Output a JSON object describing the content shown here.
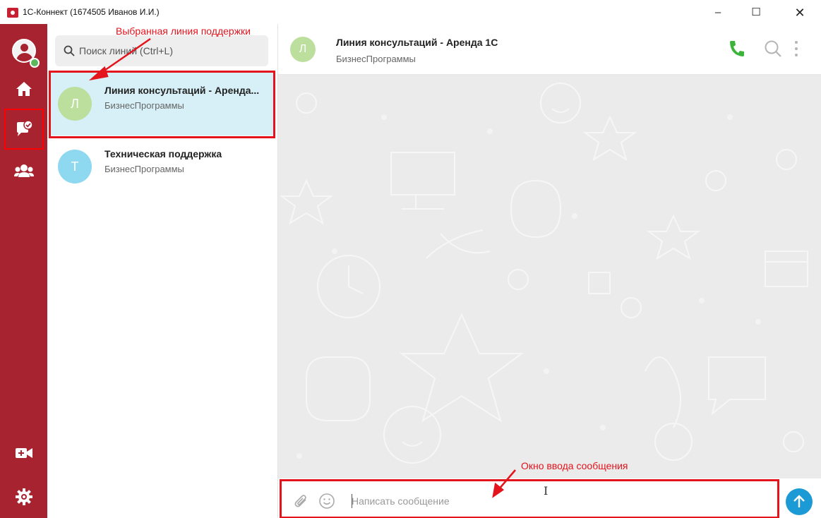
{
  "window": {
    "title": "1С-Коннект (1674505 Иванов И.И.)",
    "minimize_glyph": "–",
    "maximize_glyph": "☐",
    "close_glyph": "✕"
  },
  "rail": {
    "items": [
      {
        "name": "profile-avatar",
        "icon": "user-avatar-icon"
      },
      {
        "name": "home",
        "icon": "home-icon"
      },
      {
        "name": "support-lines",
        "icon": "chat-check-icon",
        "selected": true
      },
      {
        "name": "groups",
        "icon": "users-icon"
      },
      {
        "name": "video-call",
        "icon": "video-plus-icon"
      },
      {
        "name": "settings",
        "icon": "gear-icon"
      }
    ],
    "accent_color": "#a7232f",
    "status_color": "#5cb85c"
  },
  "lines_panel": {
    "search_placeholder": "Поиск линий (Ctrl+L)",
    "items": [
      {
        "avatar_letter": "Л",
        "avatar_color": "#bcdf9d",
        "name": "Линия консультаций - Аренда...",
        "subtitle": "БизнесПрограммы",
        "selected": true
      },
      {
        "avatar_letter": "Т",
        "avatar_color": "#8ed8f0",
        "name": "Техническая поддержка",
        "subtitle": "БизнесПрограммы",
        "selected": false
      }
    ],
    "selected_color": "#d7f0f7"
  },
  "chat": {
    "avatar_letter": "Л",
    "title": "Линия консультаций - Аренда 1С",
    "subtitle": "БизнесПрограммы",
    "call_color": "#3cb43c",
    "composer": {
      "placeholder": "Написать сообщение",
      "send_color": "#1b9ad6"
    }
  },
  "annotations": {
    "selected_line": "Выбранная линия поддержки",
    "input_window": "Окно ввода сообщения",
    "color": "#e3141c"
  }
}
